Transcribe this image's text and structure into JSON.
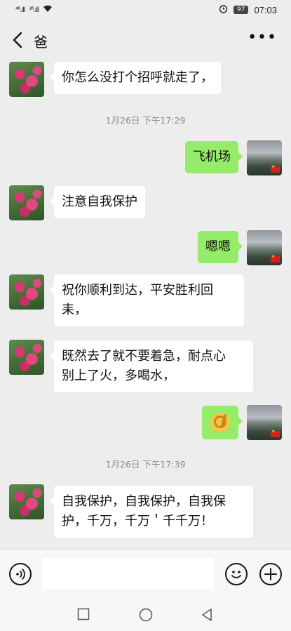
{
  "status_bar": {
    "signal1": "⁴⁶.ıll",
    "signal2": "²⁶.ıll",
    "battery": "97",
    "time": "07:03"
  },
  "header": {
    "title": "爸",
    "more": "•••"
  },
  "messages": [
    {
      "from": "dad",
      "text": "你怎么没打个招呼就走了，"
    },
    {
      "time": "1月26日 下午17:29"
    },
    {
      "from": "me",
      "text": "飞机场"
    },
    {
      "from": "dad",
      "text": "注意自我保护"
    },
    {
      "from": "me",
      "text": "嗯嗯"
    },
    {
      "from": "dad",
      "line1": "祝你顺利到达，平安胜利回",
      "line2": "耒，"
    },
    {
      "from": "dad",
      "line1": "既然去了就不要着急，耐点心",
      "line2": "别上了火，多喝水，"
    },
    {
      "from": "me",
      "emoji": "ok-hand"
    },
    {
      "time": "1月26日 下午17:39"
    },
    {
      "from": "dad",
      "line1": "自我保护，自我保护，自我保",
      "line2": "护，千万，千万＇千千万！"
    }
  ],
  "input": {
    "placeholder": "",
    "value": ""
  },
  "colors": {
    "background": "#ededed",
    "incoming_bubble": "#ffffff",
    "outgoing_bubble": "#95ec69"
  }
}
